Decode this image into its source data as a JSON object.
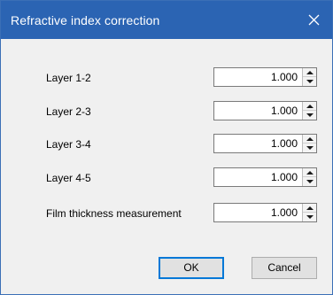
{
  "window": {
    "title": "Refractive index correction",
    "close_icon": "close-icon",
    "titlebar_color": "#2b64b3"
  },
  "fields": [
    {
      "label": "Layer 1-2",
      "value": "1.000"
    },
    {
      "label": "Layer 2-3",
      "value": "1.000"
    },
    {
      "label": "Layer 3-4",
      "value": "1.000"
    },
    {
      "label": "Layer 4-5",
      "value": "1.000"
    },
    {
      "label": "Film thickness measurement",
      "value": "1.000"
    }
  ],
  "buttons": {
    "ok_label": "OK",
    "cancel_label": "Cancel"
  }
}
